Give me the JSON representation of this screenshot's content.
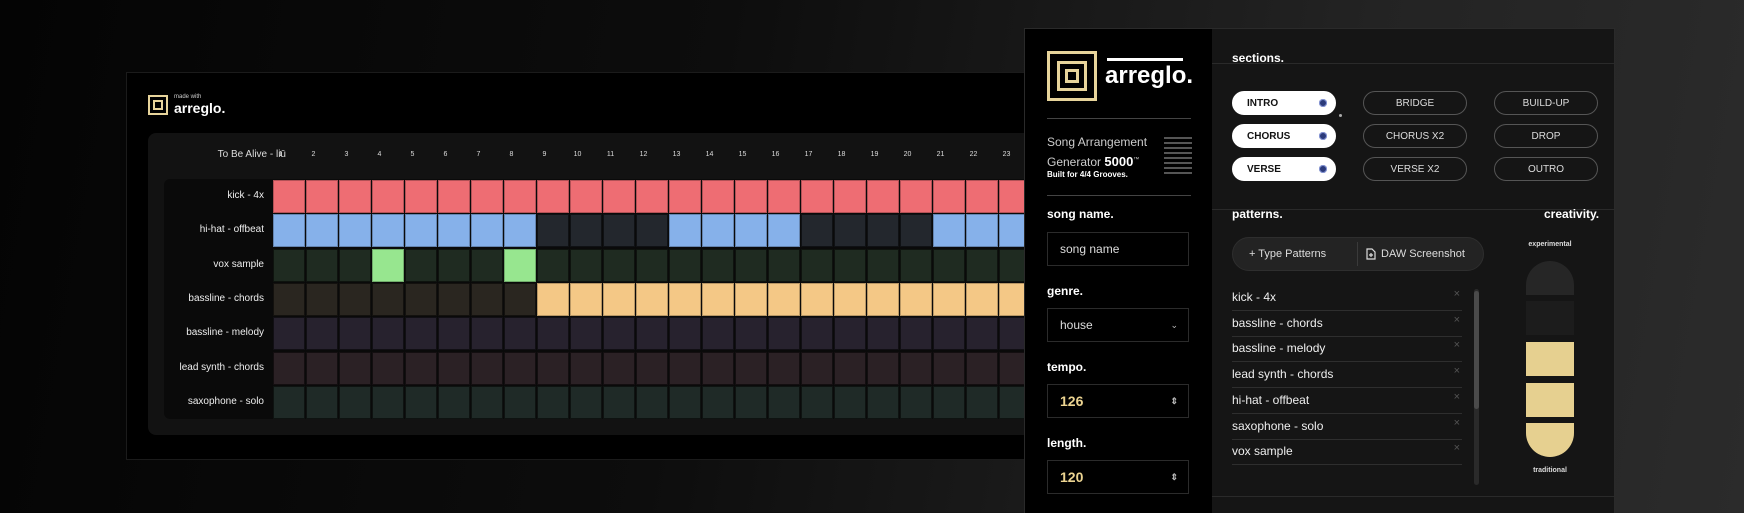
{
  "preview": {
    "made_small": "made with",
    "made_big": "arreglo.",
    "song_title": "To Be Alive - liū",
    "bar_numbers": [
      "1",
      "2",
      "3",
      "4",
      "5",
      "6",
      "7",
      "8",
      "9",
      "10",
      "11",
      "12",
      "13",
      "14",
      "15",
      "16",
      "17",
      "18",
      "19",
      "20",
      "21",
      "22",
      "23"
    ],
    "tracks": [
      {
        "label": "kick - 4x",
        "color": "#ee6d73",
        "base": "#ee6d73",
        "on": [
          1,
          2,
          3,
          4,
          5,
          6,
          7,
          8,
          9,
          10,
          11,
          12,
          13,
          14,
          15,
          16,
          17,
          18,
          19,
          20,
          21,
          22,
          23
        ]
      },
      {
        "label": "hi-hat - offbeat",
        "color": "#86b1ea",
        "base": "#23272d",
        "on": [
          1,
          2,
          3,
          4,
          5,
          6,
          7,
          8,
          13,
          14,
          15,
          16,
          21,
          22,
          23
        ]
      },
      {
        "label": "vox sample",
        "color": "#97e68f",
        "base": "#1f2b21",
        "on": [
          4,
          8
        ]
      },
      {
        "label": "bassline - chords",
        "color": "#f4c886",
        "base": "#2a2620",
        "on": [
          9,
          10,
          11,
          12,
          13,
          14,
          15,
          16,
          17,
          18,
          19,
          20,
          21,
          22,
          23
        ]
      },
      {
        "label": "bassline - melody",
        "color": "#9a8fd0",
        "base": "#27222e",
        "on": []
      },
      {
        "label": "lead synth - chords",
        "color": "#d08fa0",
        "base": "#2b2125",
        "on": []
      },
      {
        "label": "saxophone - solo",
        "color": "#8fc0b0",
        "base": "#1f2a27",
        "on": []
      }
    ]
  },
  "app": {
    "logo_text": "arreglo.",
    "subtitle_line1": "Song Arrangement",
    "subtitle_line2": "Generator",
    "subtitle_num": "5000",
    "subtitle_tm": "™",
    "built": "Built for 4/4 Grooves.",
    "song_name_label": "song name.",
    "song_name_placeholder": "song name",
    "genre_label": "genre.",
    "genre_value": "house",
    "tempo_label": "tempo.",
    "tempo_value": "126",
    "length_label": "length.",
    "length_value": "120"
  },
  "sections": {
    "title": "sections.",
    "buttons": [
      {
        "label": "INTRO",
        "active": true
      },
      {
        "label": "BRIDGE",
        "active": false
      },
      {
        "label": "BUILD-UP",
        "active": false
      },
      {
        "label": "CHORUS",
        "active": true
      },
      {
        "label": "CHORUS X2",
        "active": false
      },
      {
        "label": "DROP",
        "active": false
      },
      {
        "label": "VERSE",
        "active": true
      },
      {
        "label": "VERSE X2",
        "active": false
      },
      {
        "label": "OUTRO",
        "active": false
      }
    ]
  },
  "patterns": {
    "title": "patterns.",
    "type_button": "+ Type Patterns",
    "daw_button": "DAW Screenshot",
    "items": [
      "kick - 4x",
      "bassline - chords",
      "bassline - melody",
      "lead synth - chords",
      "hi-hat - offbeat",
      "saxophone - solo",
      "vox sample"
    ],
    "remove_glyph": "×"
  },
  "creativity": {
    "title": "creativity.",
    "top_label": "experimental",
    "bottom_label": "traditional",
    "level_filled": 3,
    "level_total": 5,
    "fill_color": "#e6d090"
  }
}
